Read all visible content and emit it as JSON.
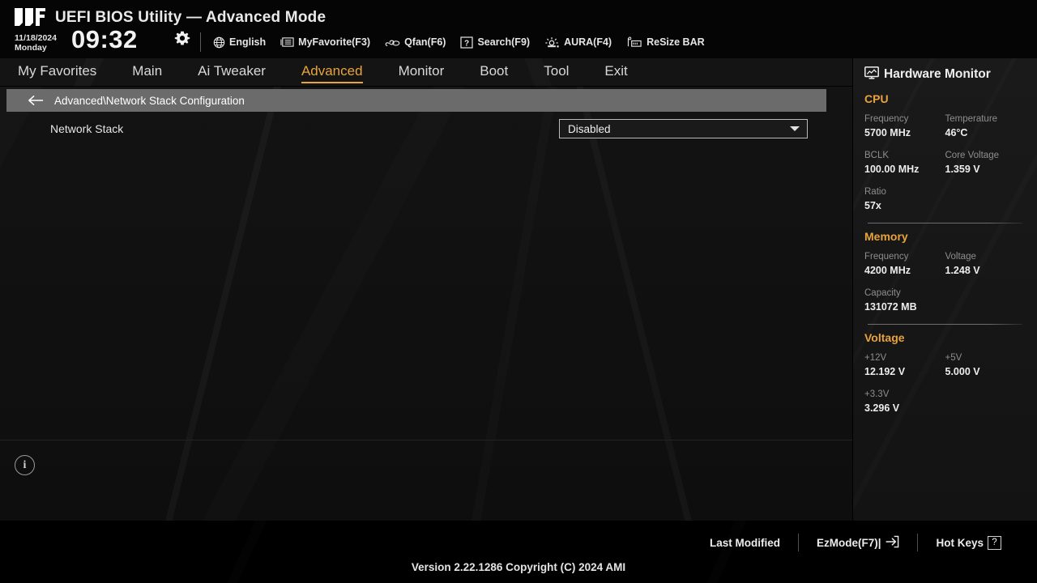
{
  "header": {
    "logo_icon": "tuf-gaming-logo",
    "title": "UEFI BIOS Utility — Advanced Mode",
    "date": "11/18/2024",
    "weekday": "Monday",
    "time": "09:32",
    "gear_icon": "gear-icon",
    "tools": [
      {
        "icon": "globe-icon",
        "label": "English"
      },
      {
        "icon": "myfavorite-icon",
        "label": "MyFavorite(F3)"
      },
      {
        "icon": "qfan-icon",
        "label": "Qfan(F6)"
      },
      {
        "icon": "question-box-icon",
        "label": "Search(F9)"
      },
      {
        "icon": "aura-icon",
        "label": "AURA(F4)"
      },
      {
        "icon": "resize-bar-icon",
        "label": "ReSize BAR"
      }
    ]
  },
  "nav": {
    "items": [
      {
        "label": "My Favorites",
        "active": false
      },
      {
        "label": "Main",
        "active": false
      },
      {
        "label": "Ai Tweaker",
        "active": false
      },
      {
        "label": "Advanced",
        "active": true
      },
      {
        "label": "Monitor",
        "active": false
      },
      {
        "label": "Boot",
        "active": false
      },
      {
        "label": "Tool",
        "active": false
      },
      {
        "label": "Exit",
        "active": false
      }
    ],
    "active_color": "#e8a33d"
  },
  "main": {
    "breadcrumb": {
      "back_icon": "back-arrow-icon",
      "path": "Advanced\\Network Stack Configuration"
    },
    "setting": {
      "label": "Network Stack",
      "value": "Disabled",
      "dropdown_icon": "chevron-down-icon"
    },
    "info_icon": "info-icon",
    "info_glyph": "i"
  },
  "sidebar": {
    "icon": "monitor-icon",
    "title": "Hardware Monitor",
    "accent_color": "#e8a33d",
    "sections": [
      {
        "title": "CPU",
        "rows": [
          [
            {
              "key": "Frequency",
              "value": "5700 MHz"
            },
            {
              "key": "Temperature",
              "value": "46°C"
            }
          ],
          [
            {
              "key": "BCLK",
              "value": "100.00 MHz"
            },
            {
              "key": "Core Voltage",
              "value": "1.359 V"
            }
          ],
          [
            {
              "key": "Ratio",
              "value": "57x"
            }
          ]
        ]
      },
      {
        "title": "Memory",
        "rows": [
          [
            {
              "key": "Frequency",
              "value": "4200 MHz"
            },
            {
              "key": "Voltage",
              "value": "1.248 V"
            }
          ],
          [
            {
              "key": "Capacity",
              "value": "131072 MB"
            }
          ]
        ]
      },
      {
        "title": "Voltage",
        "rows": [
          [
            {
              "key": "+12V",
              "value": "12.192 V"
            },
            {
              "key": "+5V",
              "value": "5.000 V"
            }
          ],
          [
            {
              "key": "+3.3V",
              "value": "3.296 V"
            }
          ]
        ]
      }
    ]
  },
  "footer": {
    "last_modified": "Last Modified",
    "ezmode": "EzMode(F7)|",
    "ezmode_icon": "exit-arrow-icon",
    "hotkeys": "Hot Keys",
    "hotkeys_key": "?",
    "version": "Version 2.22.1286 Copyright (C) 2024 AMI"
  }
}
